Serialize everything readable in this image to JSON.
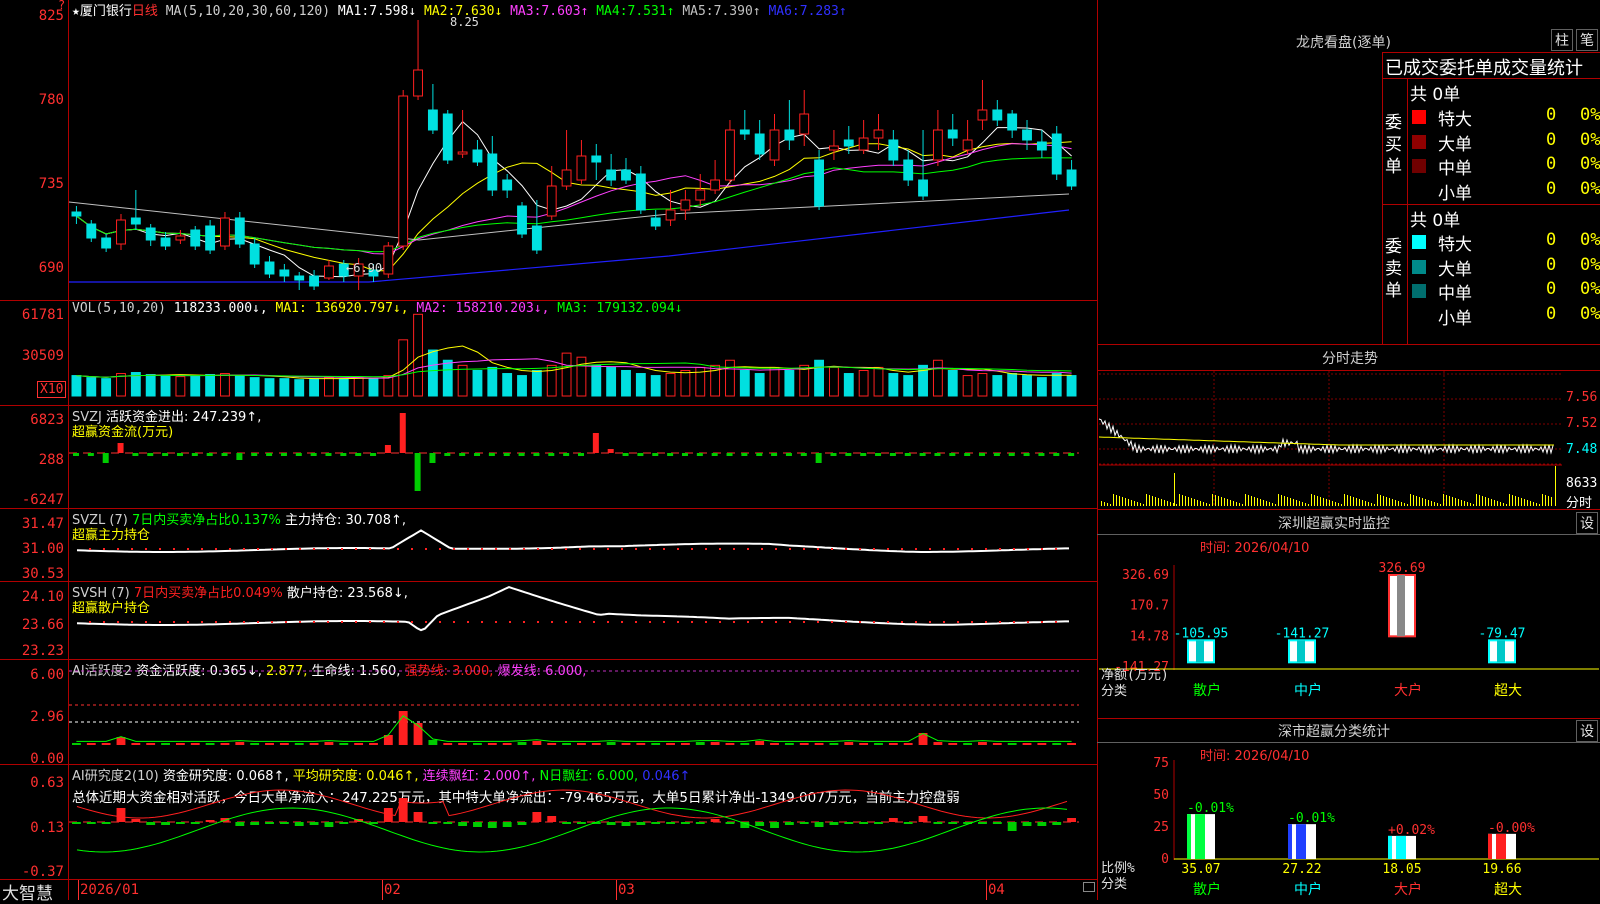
{
  "colors": {
    "up": "#ff2020",
    "down": "#00e0e0",
    "frame": "#b00000",
    "ma1": "#ffffff",
    "ma2": "#ffff00",
    "ma3": "#ff40ff",
    "ma4": "#00ff00",
    "ma5": "#c0c0c0",
    "ma6": "#2020ff"
  },
  "kline": {
    "star": "★",
    "name": "厦门银行",
    "period": "日线",
    "ma_label": "MA(5,10,20,30,60,120)",
    "ma": [
      {
        "k": "MA1:",
        "v": "7.598↓"
      },
      {
        "k": "MA2:",
        "v": "7.630↓"
      },
      {
        "k": "MA3:",
        "v": "7.603↑"
      },
      {
        "k": "MA4:",
        "v": "7.531↑"
      },
      {
        "k": "MA5:",
        "v": "7.390↑"
      },
      {
        "k": "MA6:",
        "v": "7.283↑"
      }
    ],
    "y_labels": [
      "825",
      "780",
      "735",
      "690"
    ],
    "high_label": "8.25",
    "low_label": "←6.90",
    "corner_mark": "?"
  },
  "vol": {
    "label": "VOL(5,10,20)",
    "value": "118233.000↓",
    "ma1": "MA1: 136920.797↓",
    "ma2": "MA2: 158210.203↓",
    "ma3": "MA3: 179132.094↓",
    "y_labels": [
      "61781",
      "30509"
    ],
    "unit": "X10"
  },
  "svzj": {
    "label": "SVZJ",
    "desc": "活跃资金进出: 247.239↑,",
    "subtitle": "超赢资金流(万元)",
    "y_labels": [
      "6823",
      "288",
      "-6247"
    ]
  },
  "svzl": {
    "label": "SVZL (7)",
    "ratio": "7日内买卖净占比0.137%",
    "hold": "主力持仓: 30.708↑,",
    "subtitle": "超赢主力持仓",
    "y_labels": [
      "31.47",
      "31.00",
      "30.53"
    ]
  },
  "svsh": {
    "label": "SVSH (7)",
    "ratio": "7日内买卖净占比0.049%",
    "hold": "散户持仓: 23.568↓,",
    "subtitle": "超赢散户持仓",
    "y_labels": [
      "24.10",
      "23.66",
      "23.23"
    ]
  },
  "ai1": {
    "label": "AI活跃度2",
    "f1": "资金活跃度: 0.365↓,",
    "f2": "2.877,",
    "f3": "生命线: 1.560,",
    "f4": "强势线: 3.000,",
    "f5": "爆发线: 6.000,",
    "y_labels": [
      "6.00",
      "2.96",
      "0.00"
    ]
  },
  "ai2": {
    "label": "AI研究度2(10)",
    "f1": "资金研究度: 0.068↑,",
    "f2": "平均研究度: 0.046↑,",
    "f3": "连续飘红: 2.000↑,",
    "f4": "N日飘红: 6.000,",
    "f5": "0.046↑",
    "summary": "总体近期大资金相对活跃，今日大单净流入：247.225万元，其中特大单净流出：-79.465万元，大单5日累计净出-1349.007万元，当前主力控盘弱",
    "y_labels": [
      "0.63",
      "0.13",
      "-0.37"
    ]
  },
  "bottom": {
    "brand": "大智慧",
    "dates": [
      "2026/01",
      "02",
      "03",
      "04"
    ]
  },
  "dragon": {
    "title": "龙虎看盘(逐单)",
    "btn1": "柱",
    "btn2": "笔",
    "header": "已成交委托单成交量统计",
    "buy_side": "委买单",
    "sell_side": "委卖单",
    "buy_total": "共 0单",
    "sell_total": "共 0单",
    "rows_buy": [
      {
        "name": "特大",
        "n": "0",
        "p": "0%",
        "color": "#ff0000"
      },
      {
        "name": "大单",
        "n": "0",
        "p": "0%",
        "color": "#900000"
      },
      {
        "name": "中单",
        "n": "0",
        "p": "0%",
        "color": "#700000"
      },
      {
        "name": "小单",
        "n": "0",
        "p": "0%",
        "color": "#000000"
      }
    ],
    "rows_sell": [
      {
        "name": "特大",
        "n": "0",
        "p": "0%",
        "color": "#00ffff"
      },
      {
        "name": "大单",
        "n": "0",
        "p": "0%",
        "color": "#008a8a"
      },
      {
        "name": "中单",
        "n": "0",
        "p": "0%",
        "color": "#006e6e"
      },
      {
        "name": "小单",
        "n": "0",
        "p": "0%",
        "color": "#000000"
      }
    ]
  },
  "intraday": {
    "title": "分时走势",
    "y_labels": [
      "7.56",
      "7.52",
      "7.48"
    ],
    "vol_label": "8633",
    "bottom_label": "分时"
  },
  "sz_monitor": {
    "title": "深圳超赢实时监控",
    "set": "设",
    "time": "时间: 2026/04/10",
    "y_labels": [
      "326.69",
      "170.7",
      "14.78",
      "-141.27"
    ],
    "axis_title": "净额(万元)",
    "axis_cat": "分类",
    "categories": [
      "散户",
      "中户",
      "大户",
      "超大"
    ],
    "values": [
      -105.95,
      -141.27,
      326.69,
      -79.47
    ],
    "value_labels": [
      "-105.95",
      "-141.27",
      "326.69",
      "-79.47"
    ]
  },
  "sz_stats": {
    "title": "深市超赢分类统计",
    "set": "设",
    "time": "时间: 2026/04/10",
    "y_labels": [
      "75",
      "50",
      "25",
      "0"
    ],
    "axis_title": "比例%",
    "axis_cat": "分类",
    "categories": [
      "散户",
      "中户",
      "大户",
      "超大"
    ],
    "values": [
      35.07,
      27.22,
      18.05,
      19.66
    ],
    "value_labels": [
      "35.07",
      "27.22",
      "18.05",
      "19.66"
    ],
    "change_labels": [
      "-0.01%",
      "-0.01%",
      "+0.02%",
      "-0.00%"
    ],
    "bar_colors": [
      "#00ff40",
      "#2040ff",
      "#00ffff",
      "#ff2020"
    ]
  },
  "chart_data": {
    "type": "bar",
    "title": "深圳超赢实时监控",
    "ylabel": "净额(万元)",
    "categories": [
      "散户",
      "中户",
      "大户",
      "超大"
    ],
    "series": [
      {
        "name": "净额(万元)",
        "values": [
          -105.95,
          -141.27,
          326.69,
          -79.47
        ]
      }
    ],
    "ylim": [
      -141.27,
      326.69
    ]
  }
}
